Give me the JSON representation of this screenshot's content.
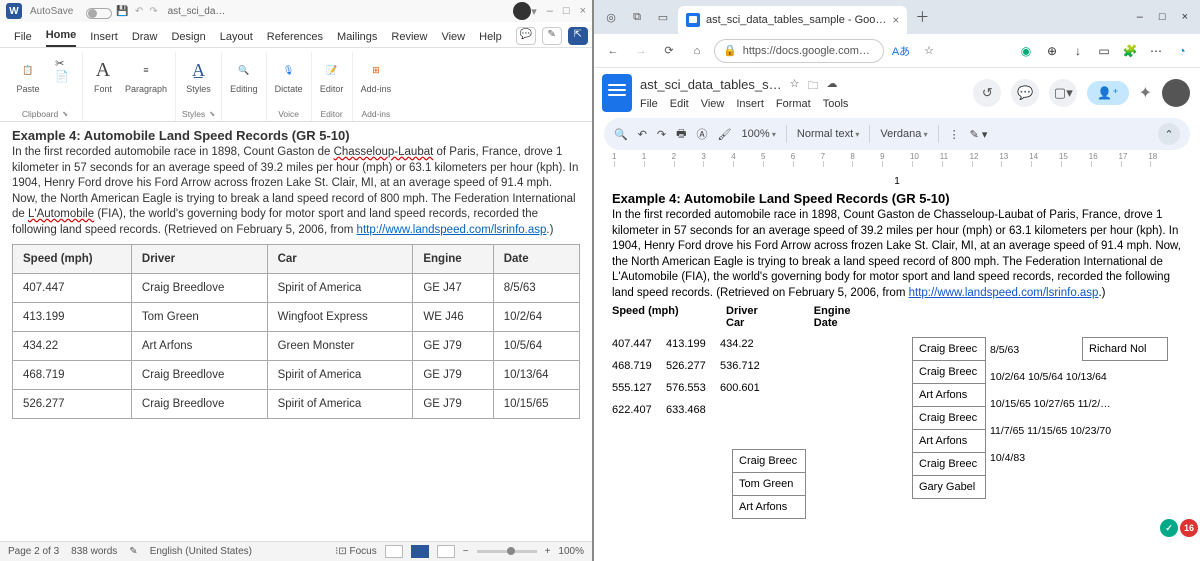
{
  "word": {
    "titlebar": {
      "autosave_label": "AutoSave",
      "filename": "ast_sci_da…",
      "min": "–",
      "max": "□",
      "close": "×"
    },
    "menu": [
      "File",
      "Home",
      "Insert",
      "Draw",
      "Design",
      "Layout",
      "References",
      "Mailings",
      "Review",
      "View",
      "Help"
    ],
    "menu_active": "Home",
    "ribbon": {
      "paste": "Paste",
      "font": "Font",
      "paragraph": "Paragraph",
      "styles": "Styles",
      "editing": "Editing",
      "dictate": "Dictate",
      "editor": "Editor",
      "addins": "Add-ins",
      "grp_clipboard": "Clipboard",
      "grp_styles": "Styles",
      "grp_voice": "Voice",
      "grp_editor": "Editor",
      "grp_addins": "Add-ins"
    },
    "doc": {
      "heading": "Example 4: Automobile Land Speed Records (GR 5-10)",
      "para_pre": "In the first recorded automobile race in 1898, Count Gaston de ",
      "para_red1": "Chasseloup-Laubat",
      "para_mid": " of Paris, France, drove 1 kilometer in 57 seconds for an average speed of 39.2 miles per hour (mph) or 63.1 kilometers per hour (kph). In 1904, Henry Ford drove his Ford Arrow across frozen Lake St. Clair, MI, at an average speed of 91.4 mph. Now, the North American Eagle is trying to break a land speed record of 800 mph. The Federation International de ",
      "para_red2": "L'Automobile",
      "para_post": " (FIA), the world's governing body for motor sport and land speed records, recorded the following land speed records. (Retrieved on February 5, 2006, from ",
      "link": "http://www.landspeed.com/lsrinfo.asp",
      "para_end": ".)",
      "headers": [
        "Speed (mph)",
        "Driver",
        "Car",
        "Engine",
        "Date"
      ],
      "rows": [
        [
          "407.447",
          "Craig Breedlove",
          "Spirit of America",
          "GE J47",
          "8/5/63"
        ],
        [
          "413.199",
          "Tom Green",
          "Wingfoot Express",
          "WE J46",
          "10/2/64"
        ],
        [
          "434.22",
          "Art Arfons",
          "Green Monster",
          "GE J79",
          "10/5/64"
        ],
        [
          "468.719",
          "Craig Breedlove",
          "Spirit of America",
          "GE J79",
          "10/13/64"
        ],
        [
          "526.277",
          "Craig Breedlove",
          "Spirit of America",
          "GE J79",
          "10/15/65"
        ]
      ]
    },
    "status": {
      "page": "Page 2 of 3",
      "words": "838 words",
      "lang": "English (United States)",
      "focus": "Focus",
      "zoom": "100%"
    }
  },
  "browser": {
    "tab_title": "ast_sci_data_tables_sample - Goo…",
    "url": "https://docs.google.com…",
    "win": {
      "min": "–",
      "max": "□",
      "close": "×"
    }
  },
  "docs": {
    "title": "ast_sci_data_tables_s…",
    "menus": [
      "File",
      "Edit",
      "View",
      "Insert",
      "Format",
      "Tools"
    ],
    "fmt": {
      "zoom": "100%",
      "style": "Normal text",
      "font": "Verdana"
    },
    "ruler": [
      "1",
      "1",
      "2",
      "3",
      "4",
      "5",
      "6",
      "7",
      "8",
      "9",
      "10",
      "11",
      "12",
      "13",
      "14",
      "15",
      "16",
      "17",
      "18"
    ],
    "pagenum": "1",
    "heading": "Example 4: Automobile Land Speed Records (GR 5-10)",
    "para": "In the first recorded automobile race in 1898, Count Gaston de Chasseloup-Laubat of Paris, France, drove 1 kilometer in 57 seconds for an average speed of 39.2 miles per hour  (mph) or 63.1 kilometers per hour (kph). In 1904, Henry Ford drove his Ford Arrow across  frozen Lake St. Clair, MI, at an average speed of 91.4 mph. Now, the North American  Eagle is trying to break a land speed record of 800 mph. The Federation International de  L'Automobile (FIA), the world's governing body for motor sport and land speed records,  recorded the following land speed records. (Retrieved on February 5, 2006, from  ",
    "link": "http://www.landspeed.com/lsrinfo.asp",
    "para_end": ".)",
    "mess": {
      "col1_hdr": "Speed (mph)",
      "hdr_stack": [
        "Driver",
        "Car"
      ],
      "hdr_stack2": [
        "Engine",
        "Date"
      ],
      "num_rows": [
        [
          "407.447",
          "413.199",
          "434.22"
        ],
        [
          "468.719",
          "526.277",
          "536.712"
        ],
        [
          "555.127",
          "576.553",
          "600.601"
        ],
        [
          "622.407",
          "633.468",
          ""
        ]
      ],
      "box_a": [
        "Craig Breec",
        "Tom Green",
        "Art Arfons"
      ],
      "box_b": [
        "Craig Breec",
        "Craig Breec",
        "Art Arfons",
        "Craig Breec",
        "Art Arfons",
        "Craig Breec",
        "Gary Gabel"
      ],
      "box_c": [
        "Richard Nol"
      ],
      "dates_b": [
        "",
        "",
        "8/5/63",
        "10/2/64 10/5/64 10/13/64",
        "10/15/65 10/27/65 11/2/…",
        "11/7/65 11/15/65 10/23/70",
        "10/4/83"
      ]
    },
    "badges": {
      "green": "✓",
      "red": "16"
    }
  },
  "chart_data": {
    "type": "table",
    "title": "Automobile Land Speed Records",
    "columns": [
      "Speed (mph)",
      "Driver",
      "Car",
      "Engine",
      "Date"
    ],
    "rows": [
      [
        407.447,
        "Craig Breedlove",
        "Spirit of America",
        "GE J47",
        "8/5/63"
      ],
      [
        413.199,
        "Tom Green",
        "Wingfoot Express",
        "WE J46",
        "10/2/64"
      ],
      [
        434.22,
        "Art Arfons",
        "Green Monster",
        "GE J79",
        "10/5/64"
      ],
      [
        468.719,
        "Craig Breedlove",
        "Spirit of America",
        "GE J79",
        "10/13/64"
      ],
      [
        526.277,
        "Craig Breedlove",
        "Spirit of America",
        "GE J79",
        "10/15/65"
      ]
    ]
  }
}
